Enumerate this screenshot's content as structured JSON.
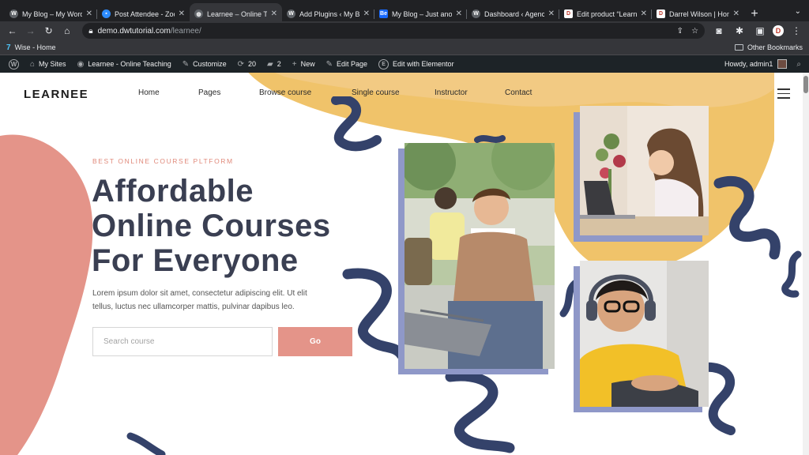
{
  "browser": {
    "tabs": [
      {
        "title": "My Blog – My WordPress",
        "favicon": "wordpress-icon",
        "active": false
      },
      {
        "title": "Post Attendee - Zoom",
        "favicon": "zoom-icon",
        "active": false
      },
      {
        "title": "Learnee – Online Teaching",
        "favicon": "globe-icon",
        "active": true
      },
      {
        "title": "Add Plugins ‹ My Blog",
        "favicon": "wordpress-icon",
        "active": false
      },
      {
        "title": "My Blog – Just another",
        "favicon": "behance-icon",
        "active": false
      },
      {
        "title": "Dashboard ‹ Agency",
        "favicon": "wordpress-icon",
        "active": false
      },
      {
        "title": "Edit product “Learnee”",
        "favicon": "d-icon",
        "active": false
      },
      {
        "title": "Darrel Wilson | Home",
        "favicon": "d-icon",
        "active": false
      }
    ],
    "url_host": "demo.dwtutorial.com",
    "url_path": "/learnee/",
    "bookmarks": {
      "first": "Wise - Home",
      "other": "Other Bookmarks"
    },
    "profile_initial": "D"
  },
  "wp_admin_bar": {
    "my_sites": "My Sites",
    "site_name": "Learnee - Online Teaching",
    "customize": "Customize",
    "updates_count": "20",
    "comments_count": "2",
    "new": "New",
    "edit_page": "Edit Page",
    "edit_elementor": "Edit with Elementor",
    "howdy": "Howdy, admin1"
  },
  "site": {
    "logo": "LEARNEE",
    "menu": {
      "home": "Home",
      "pages": "Pages",
      "browse": "Browse course",
      "single": "Single course",
      "instructor": "Instructor",
      "contact": "Contact"
    },
    "hero": {
      "eyebrow": "BEST ONLINE COURSE PLTFORM",
      "line1": "Affordable",
      "line2": "Online Courses",
      "line3": "For Everyone",
      "description": "Lorem ipsum dolor sit amet, consectetur adipiscing elit. Ut elit tellus, luctus nec ullamcorper mattis, pulvinar dapibus leo.",
      "search_placeholder": "Search course",
      "go_label": "Go"
    },
    "colors": {
      "accent_pink": "#e49489",
      "blob_yellow": "#f0c36a",
      "navy": "#34426a",
      "frame_purple": "#8f98c8",
      "heading": "#3a3f52"
    }
  }
}
